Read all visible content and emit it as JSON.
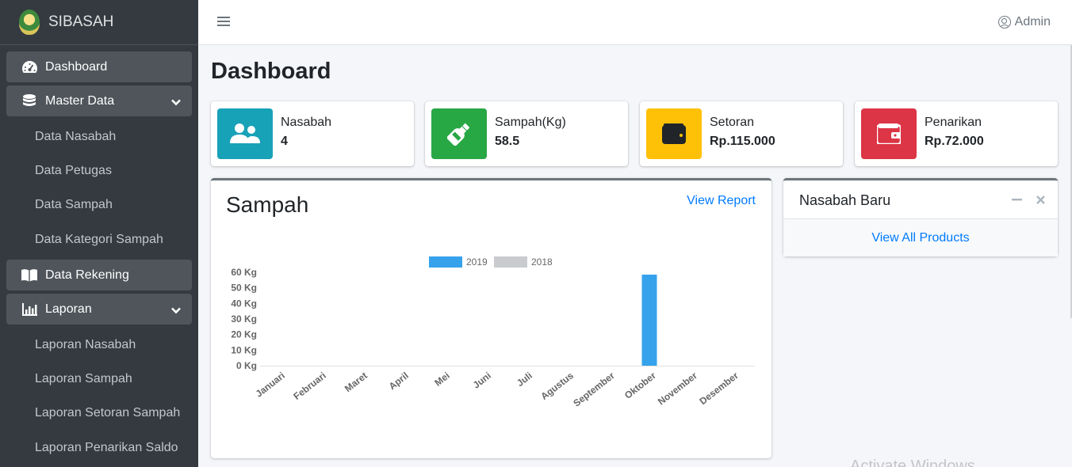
{
  "brand": {
    "name": "SIBASAH"
  },
  "sidebar": {
    "dashboard": "Dashboard",
    "master_data": "Master Data",
    "master_items": [
      "Data Nasabah",
      "Data Petugas",
      "Data Sampah",
      "Data Kategori Sampah"
    ],
    "data_rekening": "Data Rekening",
    "laporan": "Laporan",
    "laporan_items": [
      "Laporan Nasabah",
      "Laporan Sampah",
      "Laporan Setoran Sampah",
      "Laporan Penarikan Saldo"
    ]
  },
  "topbar": {
    "user": "Admin"
  },
  "page": {
    "title": "Dashboard"
  },
  "info_boxes": [
    {
      "label": "Nasabah",
      "value": "4",
      "color": "#17a2b8",
      "icon": "users-icon"
    },
    {
      "label": "Sampah(Kg)",
      "value": "58.5",
      "color": "#28a745",
      "icon": "bottle-icon"
    },
    {
      "label": "Setoran",
      "value": "Rp.115.000",
      "color": "#ffc107",
      "icon": "wallet-icon"
    },
    {
      "label": "Penarikan",
      "value": "Rp.72.000",
      "color": "#dc3545",
      "icon": "wallet-out-icon"
    }
  ],
  "sampah_card": {
    "title": "Sampah",
    "link": "View Report"
  },
  "nasabah_card": {
    "title": "Nasabah Baru",
    "footer_link": "View All Products"
  },
  "watermark": "Activate Windows",
  "chart_data": {
    "type": "bar",
    "categories": [
      "Januari",
      "Februari",
      "Maret",
      "April",
      "Mei",
      "Juni",
      "Juli",
      "Agustus",
      "September",
      "Oktober",
      "November",
      "Desember"
    ],
    "series": [
      {
        "name": "2019",
        "color": "#36a2eb",
        "values": [
          0,
          0,
          0,
          0,
          0,
          0,
          0,
          0,
          0,
          58.5,
          0,
          0
        ]
      },
      {
        "name": "2018",
        "color": "#c9cbcf",
        "values": [
          0,
          0,
          0,
          0,
          0,
          0,
          0,
          0,
          0,
          0,
          0,
          0
        ]
      }
    ],
    "yticks": [
      "0 Kg",
      "10 Kg",
      "20 Kg",
      "30 Kg",
      "40 Kg",
      "50 Kg",
      "60 Kg"
    ],
    "ylim": [
      0,
      60
    ],
    "legend": "top"
  }
}
